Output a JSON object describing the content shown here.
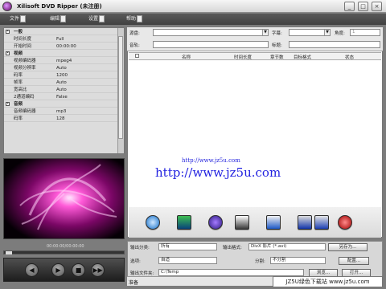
{
  "titlebar": {
    "title": "Xilisoft DVD Ripper (未注册)",
    "minimize": "_",
    "maximize": "□",
    "close": "×"
  },
  "menu": [
    "文件",
    "编辑",
    "设置",
    "帮助"
  ],
  "properties": [
    {
      "type": "group",
      "name": "一般"
    },
    {
      "type": "row",
      "name": "时间长度",
      "value": "Full"
    },
    {
      "type": "row",
      "name": "开始时间",
      "value": "00:00:00"
    },
    {
      "type": "group",
      "name": "视频"
    },
    {
      "type": "row",
      "name": "视频编码器",
      "value": "mpeg4"
    },
    {
      "type": "row",
      "name": "视频分辨率",
      "value": "Auto"
    },
    {
      "type": "row",
      "name": "码率",
      "value": "1200"
    },
    {
      "type": "row",
      "name": "帧率",
      "value": "Auto"
    },
    {
      "type": "row",
      "name": "宽高比",
      "value": "Auto"
    },
    {
      "type": "row",
      "name": "2通道编码",
      "value": "False"
    },
    {
      "type": "group",
      "name": "音频"
    },
    {
      "type": "row",
      "name": "音频编码器",
      "value": "mp3"
    },
    {
      "type": "row",
      "name": "码率",
      "value": "128"
    }
  ],
  "player": {
    "time": "00:00:00/00:00:00",
    "buttons": [
      "◀",
      "▶",
      "■",
      "▶▶"
    ]
  },
  "form": {
    "dvd_label": "源盘:",
    "subtitle_label": "字幕:",
    "angle_label": "角度:",
    "audio_label": "音轨:",
    "title_label": "标题:",
    "angle_value": "1"
  },
  "table": {
    "columns": [
      "名称",
      "时间长度",
      "章节数",
      "目标格式",
      "状态"
    ]
  },
  "watermark": {
    "small": "http://www.jz5u.com",
    "big": "http://www.jz5u.com"
  },
  "bottom": {
    "format_label": "输出分类:",
    "format_value": "所有",
    "profile_label": "输出格式:",
    "profile_value": "DivX 影片 (*.avi)",
    "save_as": "另存为...",
    "audio_track_label": "选项:",
    "audio_track_value": "自适",
    "split_label": "分割:",
    "split_value": "不分割",
    "settings": "配置...",
    "folder_label": "输出文件夹:",
    "folder_value": "C:\\Temp",
    "browse": "浏览...",
    "open": "打开..."
  },
  "status": {
    "text": "准备",
    "logo": "JZ5U绿色下载站 www.jz5u.com"
  }
}
